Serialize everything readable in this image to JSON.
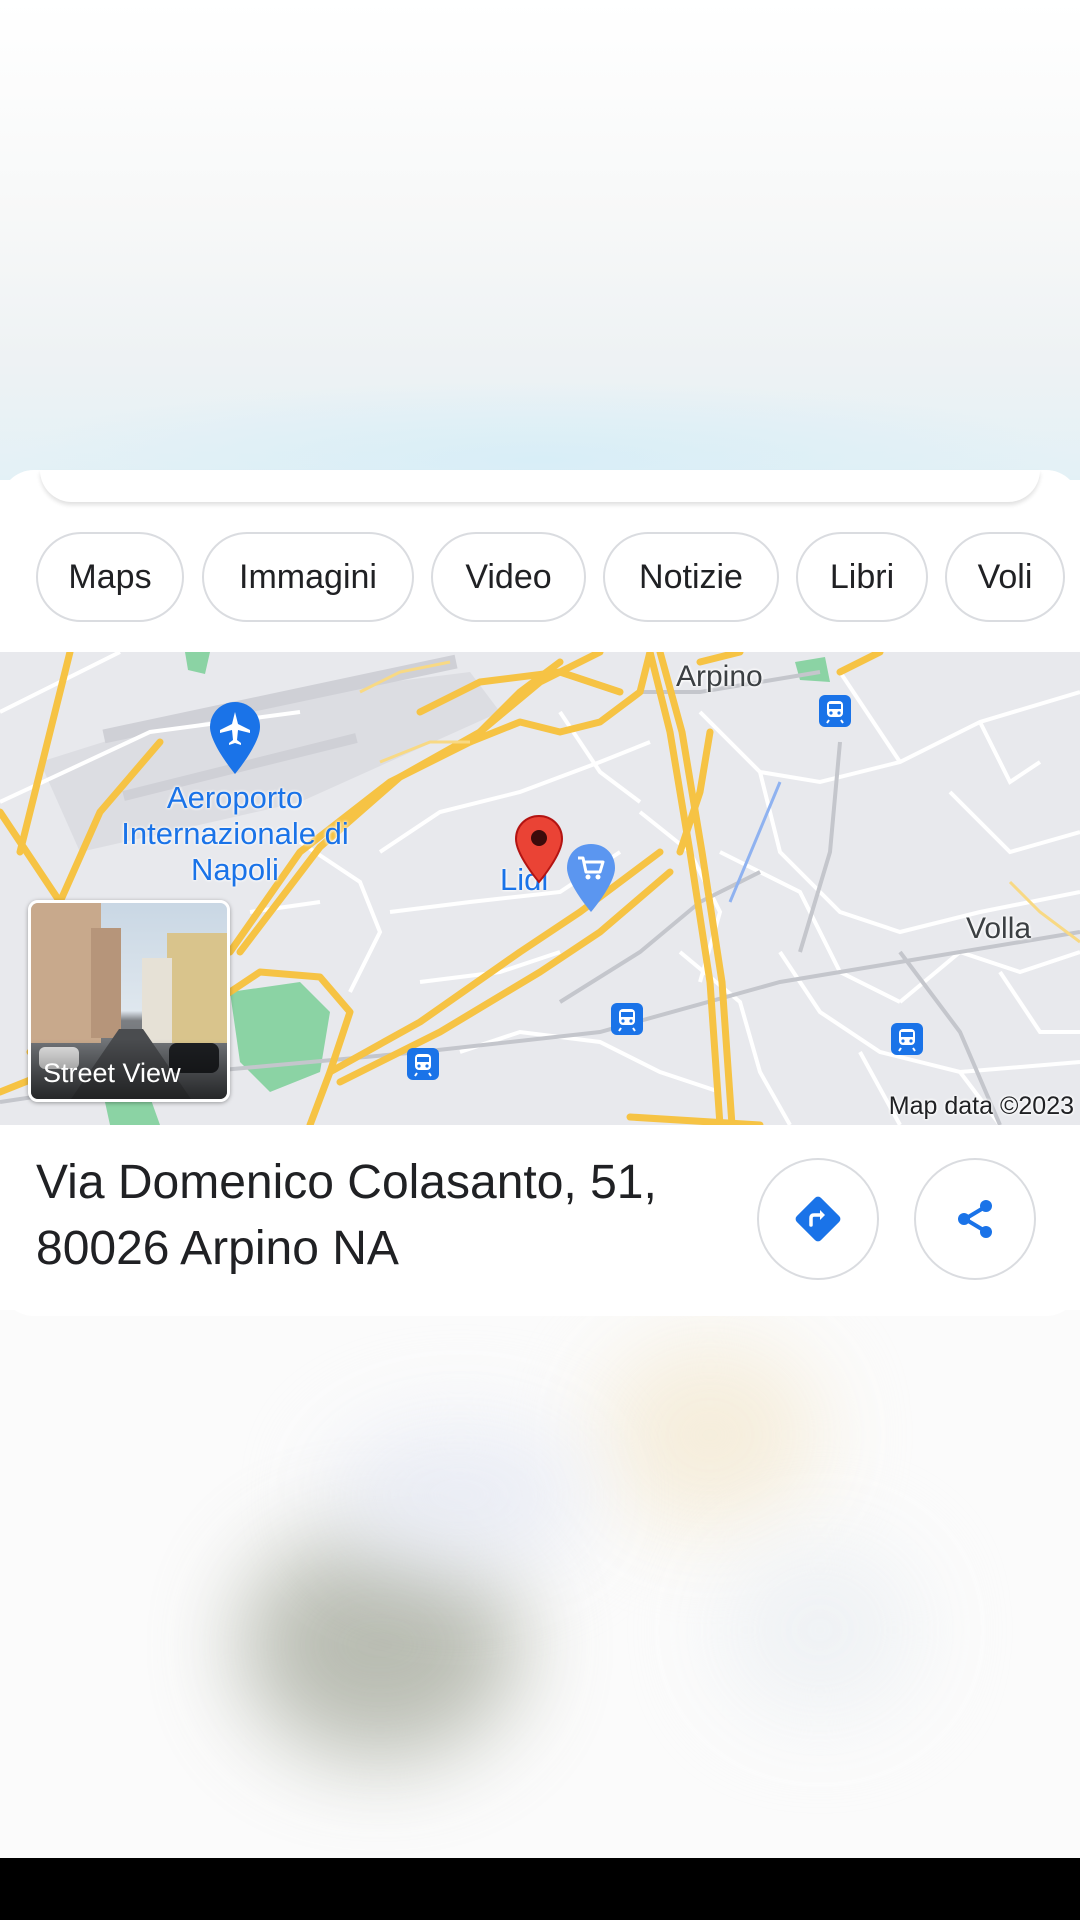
{
  "chips": [
    {
      "label": "Maps"
    },
    {
      "label": "Immagini"
    },
    {
      "label": "Video"
    },
    {
      "label": "Notizie"
    },
    {
      "label": "Libri"
    },
    {
      "label": "Voli"
    }
  ],
  "map": {
    "labels": {
      "airport": "Aeroporto Internazionale di Napoli",
      "arpino": "Arpino",
      "volla": "Volla",
      "lidl": "Lidl"
    },
    "street_view_label": "Street View",
    "attribution": "Map data ©2023",
    "icons": [
      "airport-pin-icon",
      "location-pin-icon",
      "shopping-cart-pin-icon",
      "train-station-icon"
    ],
    "colors": {
      "pin_red": "#ea4335",
      "poi_blue": "#4285f4",
      "road_yellow": "#f6c344",
      "park_green": "#8bd3a4"
    }
  },
  "place": {
    "address_line1": "Via Domenico Colasanto, 51,",
    "address_line2": "80026 Arpino NA"
  },
  "actions": {
    "directions_icon": "directions-icon",
    "share_icon": "share-icon",
    "accent_color": "#1a73e8"
  }
}
